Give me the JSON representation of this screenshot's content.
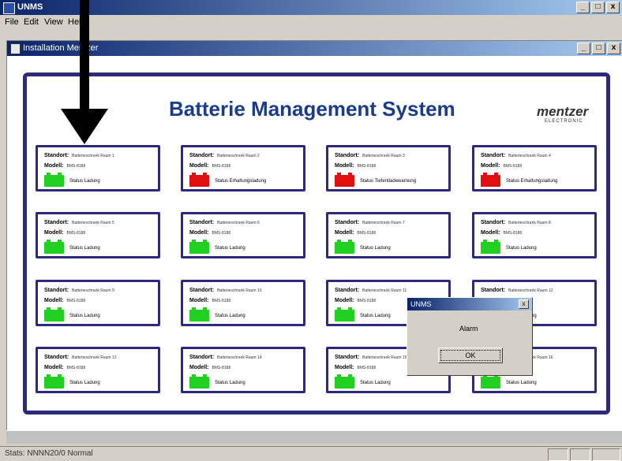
{
  "app": {
    "title": "UNMS",
    "window_buttons": [
      "_",
      "□",
      "x"
    ]
  },
  "menu": [
    "File",
    "Edit",
    "View",
    "Help"
  ],
  "mdi_window": {
    "title": "Installation Mentzer",
    "buttons": [
      "_",
      "□",
      "x"
    ]
  },
  "header": {
    "title": "Batterie Management System"
  },
  "logo": {
    "name": "mentzer",
    "sub": "ELECTRONIC"
  },
  "labels": {
    "location": "Standort:",
    "model": "Modell:"
  },
  "cards": [
    {
      "location": "Batterieschrank Raum 1",
      "model": "BMS-8188",
      "status": "Status Ladung",
      "color": "green"
    },
    {
      "location": "Batterieschrank Raum 2",
      "model": "BMS-8188",
      "status": "Status Erhaltungsladung",
      "color": "red"
    },
    {
      "location": "Batterieschrank Raum 3",
      "model": "BMS-8188",
      "status": "Status Tiefentladewarnung",
      "color": "red"
    },
    {
      "location": "Batterieschrank Raum 4",
      "model": "BMS-8188",
      "status": "Status Erhaltungsladung",
      "color": "red"
    },
    {
      "location": "Batterieschrank Raum 5",
      "model": "BMS-8188",
      "status": "Status Ladung",
      "color": "green"
    },
    {
      "location": "Batterieschrank Raum 6",
      "model": "BMS-8188",
      "status": "Status Ladung",
      "color": "green"
    },
    {
      "location": "Batterieschrank Raum 7",
      "model": "BMS-8188",
      "status": "Status Ladung",
      "color": "green"
    },
    {
      "location": "Batterieschrank Raum 8",
      "model": "BMS-8188",
      "status": "Status Ladung",
      "color": "green"
    },
    {
      "location": "Batterieschrank Raum 9",
      "model": "BMS-8188",
      "status": "Status Ladung",
      "color": "green"
    },
    {
      "location": "Batterieschrank Raum 10",
      "model": "BMS-8188",
      "status": "Status Ladung",
      "color": "green"
    },
    {
      "location": "Batterieschrank Raum 11",
      "model": "BMS-8188",
      "status": "Status Ladung",
      "color": "green"
    },
    {
      "location": "Batterieschrank Raum 12",
      "model": "BMS-8188",
      "status": "Status Ladung",
      "color": "green"
    },
    {
      "location": "Batterieschrank Raum 13",
      "model": "BMS-8188",
      "status": "Status Ladung",
      "color": "green"
    },
    {
      "location": "Batterieschrank Raum 14",
      "model": "BMS-8188",
      "status": "Status Ladung",
      "color": "green"
    },
    {
      "location": "Batterieschrank Raum 15",
      "model": "BMS-8188",
      "status": "Status Ladung",
      "color": "green"
    },
    {
      "location": "Batterieschrank Raum 16",
      "model": "BMS-8188",
      "status": "Status Ladung",
      "color": "green"
    }
  ],
  "dialog": {
    "title": "UNMS",
    "close": "x",
    "message": "Alarm",
    "ok": "OK"
  },
  "statusbar": {
    "text": "Stats: NNNN20/0 Normal"
  },
  "colors": {
    "accent_border": "#2e2a7a",
    "title_blue": "#1a3c8a",
    "battery_green": "#22d022",
    "battery_red": "#e01010"
  }
}
